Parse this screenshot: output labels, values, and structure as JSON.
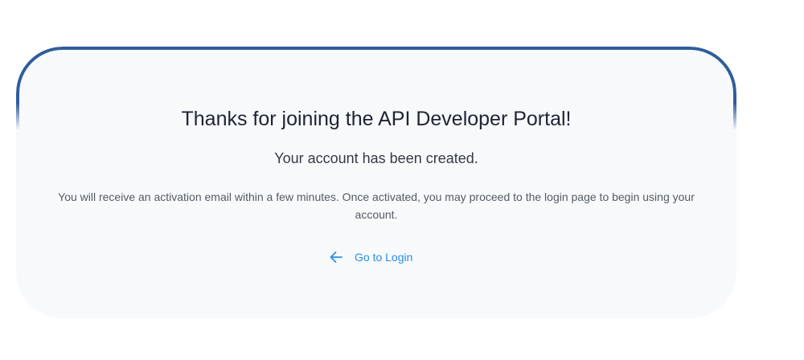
{
  "card": {
    "heading": "Thanks for joining the API Developer Portal!",
    "subheading": "Your account has been created.",
    "body": "You will receive an activation email within a few minutes. Once activated, you may proceed to the login page to begin using your account.",
    "login_link": {
      "icon": "arrow-left-icon",
      "label": "Go to Login"
    }
  },
  "colors": {
    "card_background": "#f7f9fb",
    "card_border": "#2f5d9b",
    "link": "#2a8ee8",
    "heading_text": "#1d2433"
  }
}
